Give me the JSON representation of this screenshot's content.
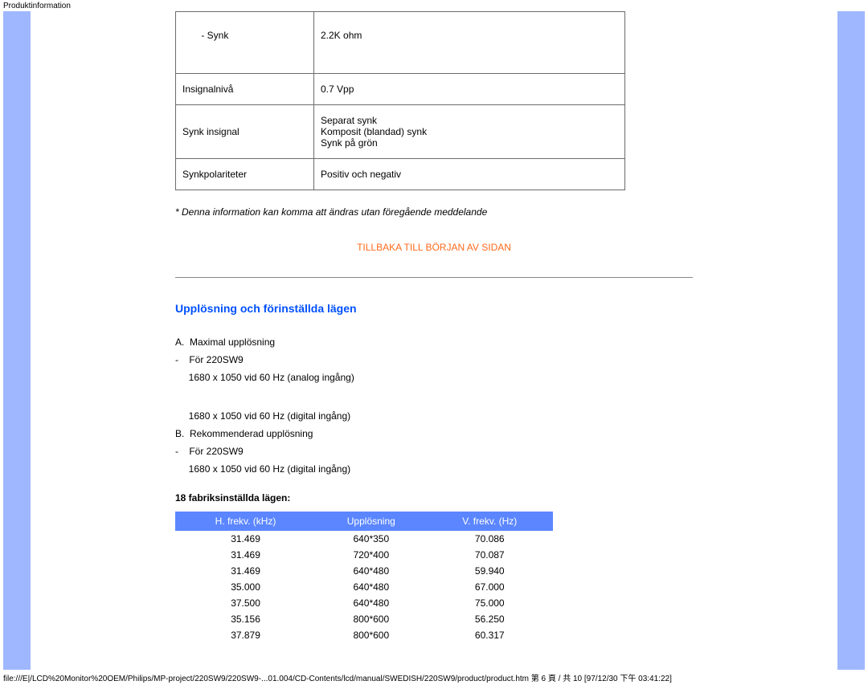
{
  "header": {
    "title": "Produktinformation"
  },
  "specs": {
    "rows": [
      {
        "label": "       - Synk",
        "value": "2.2K ohm",
        "tall": true
      },
      {
        "label": "Insignalnivå",
        "value": "0.7 Vpp"
      },
      {
        "label": "Synk insignal",
        "value": "Separat synk\nKomposit (blandad) synk\nSynk på grön"
      },
      {
        "label": "Synkpolariteter",
        "value": "Positiv och negativ"
      }
    ],
    "note": "* Denna information kan komma att ändras utan föregående meddelande"
  },
  "back_link": "TILLBAKA TILL BÖRJAN AV SIDAN",
  "resolution": {
    "title": "Upplösning och förinställda lägen",
    "lines": [
      "A.  Maximal upplösning",
      "-    För 220SW9",
      "     1680 x 1050 vid 60 Hz (analog ingång)",
      "",
      "     1680 x 1050 vid 60 Hz (digital ingång)",
      "B.  Rekommenderad upplösning",
      "-    För 220SW9",
      "     1680 x 1050 vid 60 Hz (digital ingång)"
    ],
    "modes_title": "18 fabriksinställda lägen:",
    "table_headers": [
      "H. frekv. (kHz)",
      "Upplösning",
      "V. frekv. (Hz)"
    ]
  },
  "chart_data": {
    "type": "table",
    "title": "18 fabriksinställda lägen:",
    "columns": [
      "H. frekv. (kHz)",
      "Upplösning",
      "V. frekv. (Hz)"
    ],
    "rows": [
      [
        "31.469",
        "640*350",
        "70.086"
      ],
      [
        "31.469",
        "720*400",
        "70.087"
      ],
      [
        "31.469",
        "640*480",
        "59.940"
      ],
      [
        "35.000",
        "640*480",
        "67.000"
      ],
      [
        "37.500",
        "640*480",
        "75.000"
      ],
      [
        "35.156",
        "800*600",
        "56.250"
      ],
      [
        "37.879",
        "800*600",
        "60.317"
      ]
    ]
  },
  "footer": {
    "path": "file:///E|/LCD%20Monitor%20OEM/Philips/MP-project/220SW9/220SW9-...01.004/CD-Contents/lcd/manual/SWEDISH/220SW9/product/product.htm 第 6 頁 / 共 10  [97/12/30 下午 03:41:22]"
  }
}
